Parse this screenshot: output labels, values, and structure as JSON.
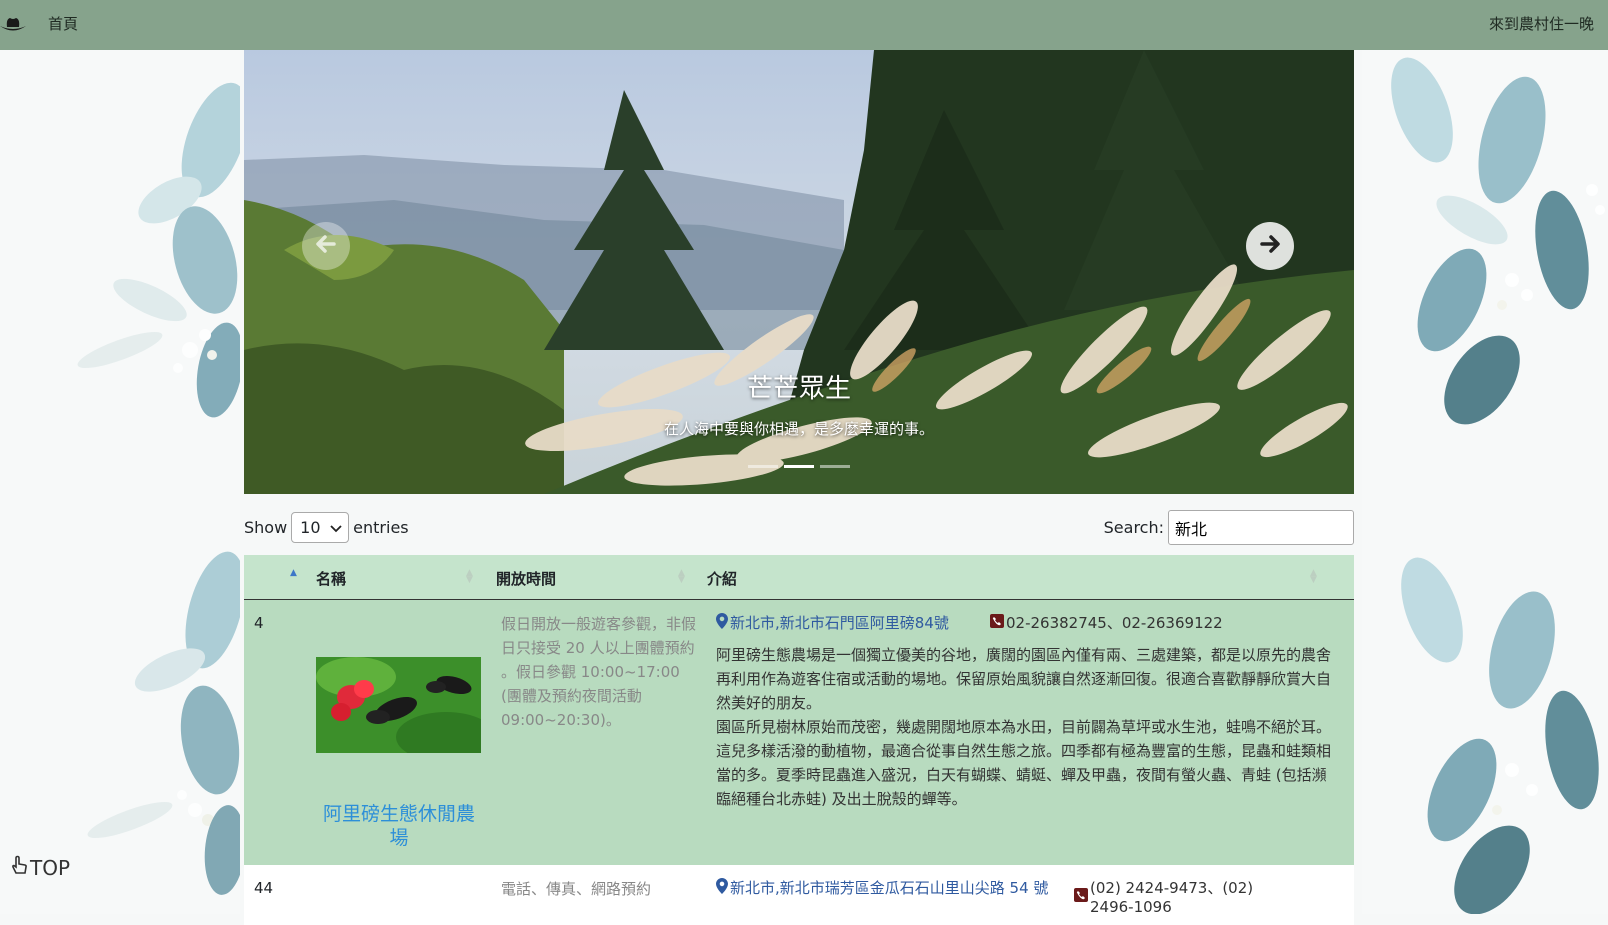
{
  "navbar": {
    "logo_icon": "hat-icon",
    "home": "首頁",
    "brand": "來到農村住一晚",
    "bg_color": "#86a38c"
  },
  "carousel": {
    "title": "芒芒眾生",
    "subtitle": "在人海中要與你相遇，是多麼幸運的事。",
    "prev_icon": "arrow-left-icon",
    "next_icon": "arrow-right-icon",
    "slides": 3,
    "active_slide": 2
  },
  "controls": {
    "show_label": "Show",
    "page_size": "10",
    "entries_label": "entries",
    "search_label": "Search:",
    "search_value": "新北"
  },
  "table": {
    "headers": [
      "名稱",
      "開放時間",
      "介紹"
    ],
    "header_color": "#c5e4cc",
    "rows": [
      {
        "num": "4",
        "name": "阿里磅生態休閒農場",
        "hours": "假日開放一般遊客參觀，非假日只接受 20 人以上團體預約 。假日參觀 10:00~17:00 (團體及預約夜間活動 09:00~20:30)。",
        "address": "新北市,新北市石門區阿里磅84號",
        "phone": "02-26382745、02-26369122",
        "intro_p1": "阿里磅生態農場是一個獨立優美的谷地，廣闊的園區內僅有兩、三處建築，都是以原先的農舍再利用作為遊客住宿或活動的場地。保留原始風貌讓自然逐漸回復。很適合喜歡靜靜欣賞大自然美好的朋友。",
        "intro_p2": "園區所見樹林原始而茂密，幾處開闊地原本為水田，目前闢為草坪或水生池，蛙鳴不絕於耳。這兒多樣活潑的動植物，最適合從事自然生態之旅。四季都有極為豐富的生態，昆蟲和蛙類相當的多。夏季時昆蟲進入盛況，白天有蝴蝶、蜻蜓、蟬及甲蟲，夜間有螢火蟲、青蛙 (包括瀕臨絕種台北赤蛙) 及出土脫殼的蟬等。",
        "image_icon": "butterfly-photo"
      },
      {
        "num": "44",
        "hours": "電話、傳真、網路預約",
        "address": "新北市,新北市瑞芳區金瓜石石山里山尖路 54 號",
        "phone": "(02) 2424-9473、(02) 2496-1096"
      }
    ]
  },
  "top_button": {
    "icon": "hand-pointer-icon",
    "label": "TOP"
  }
}
